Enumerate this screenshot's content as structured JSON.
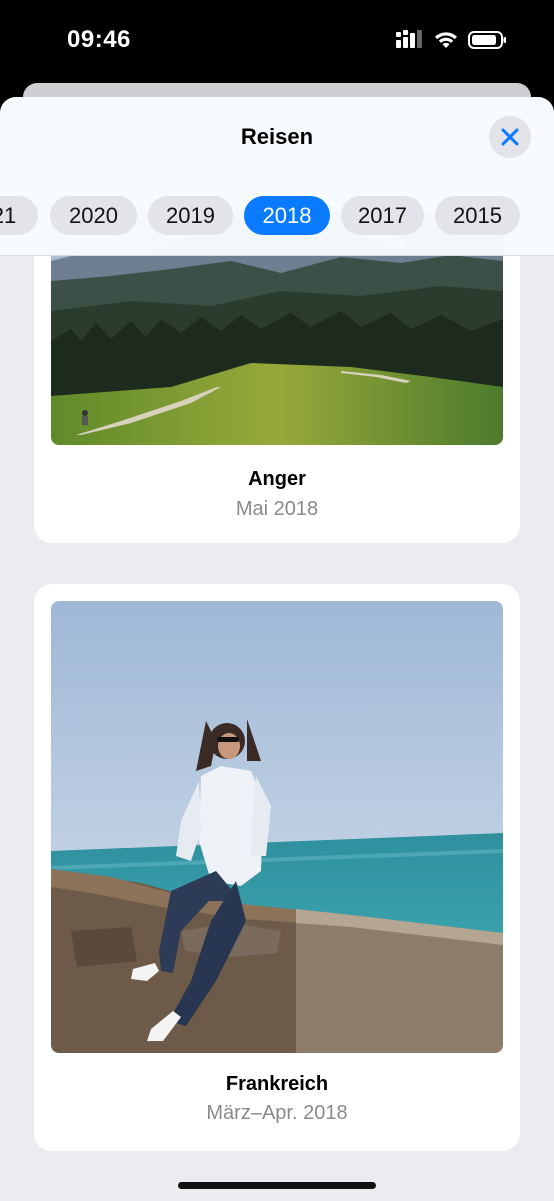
{
  "status_bar": {
    "time": "09:46"
  },
  "header": {
    "title": "Reisen"
  },
  "years": [
    {
      "label": "21",
      "selected": false
    },
    {
      "label": "2020",
      "selected": false
    },
    {
      "label": "2019",
      "selected": false
    },
    {
      "label": "2018",
      "selected": true
    },
    {
      "label": "2017",
      "selected": false
    },
    {
      "label": "2015",
      "selected": false
    }
  ],
  "trips": [
    {
      "title": "Anger",
      "date": "Mai 2018"
    },
    {
      "title": "Frankreich",
      "date": "März–Apr. 2018"
    }
  ],
  "colors": {
    "accent": "#0A7AFF",
    "background": "#EBEBF0",
    "secondary_text": "#8A8A8E"
  }
}
